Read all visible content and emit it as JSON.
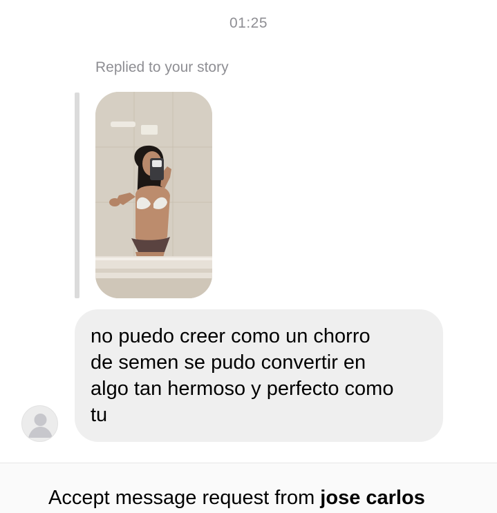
{
  "thread": {
    "timestamp": "01:25",
    "reply_label": "Replied to your story"
  },
  "story_preview": {
    "icon": "story-photo-thumbnail"
  },
  "message": {
    "sender_avatar_icon": "default-avatar-icon",
    "text": "no puedo creer como un chorro\nde semen se pudo convertir en\nalgo tan hermoso y perfecto como\ntu"
  },
  "request_banner": {
    "prefix": "Accept message request from ",
    "sender_name": "jose carlos"
  },
  "colors": {
    "meta_text": "#8e8e93",
    "bubble_bg": "#efefef",
    "reply_bar": "#dbdbdb",
    "footer_bg": "#fafafa"
  }
}
